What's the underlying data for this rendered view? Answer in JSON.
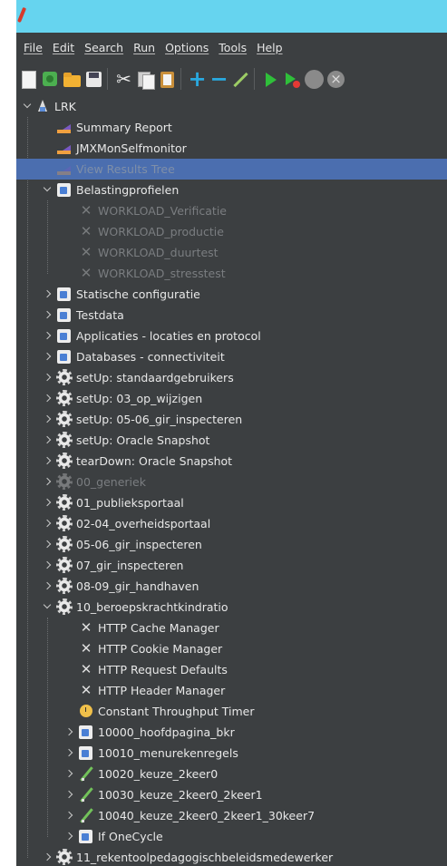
{
  "menu": [
    "File",
    "Edit",
    "Search",
    "Run",
    "Options",
    "Tools",
    "Help"
  ],
  "toolbar": [
    {
      "id": "new",
      "icon": "new-file-icon"
    },
    {
      "id": "templates",
      "icon": "templates-icon"
    },
    {
      "id": "open",
      "icon": "open-folder-icon"
    },
    {
      "id": "save",
      "icon": "save-icon"
    },
    {
      "sep": true
    },
    {
      "id": "cut",
      "icon": "cut-icon",
      "glyph": "✂"
    },
    {
      "id": "copy",
      "icon": "copy-icon"
    },
    {
      "id": "paste",
      "icon": "paste-icon"
    },
    {
      "sep": true
    },
    {
      "id": "expand",
      "icon": "plus-icon",
      "glyph": "+"
    },
    {
      "id": "collapse",
      "icon": "minus-icon",
      "glyph": "−"
    },
    {
      "id": "toggle",
      "icon": "toggle-icon"
    },
    {
      "sep": true
    },
    {
      "id": "start",
      "icon": "start-icon"
    },
    {
      "id": "start-no-pause",
      "icon": "start-no-pauses-icon"
    },
    {
      "id": "stop",
      "icon": "stop-icon"
    },
    {
      "id": "shutdown",
      "icon": "shutdown-icon"
    }
  ],
  "tree": [
    {
      "label": "LRK",
      "icon": "testplan",
      "level": 0,
      "state": "open",
      "enabled": true,
      "selected": false
    },
    {
      "label": "Summary Report",
      "icon": "listener",
      "level": 1,
      "state": "none",
      "enabled": true,
      "selected": false
    },
    {
      "label": "JMXMonSelfmonitor",
      "icon": "listener",
      "level": 1,
      "state": "none",
      "enabled": true,
      "selected": false
    },
    {
      "label": "View Results Tree",
      "icon": "listener",
      "level": 1,
      "state": "none",
      "enabled": false,
      "selected": true
    },
    {
      "label": "Belastingprofielen",
      "icon": "threadgroup",
      "level": 1,
      "state": "open",
      "enabled": true,
      "selected": false
    },
    {
      "label": "WORKLOAD_Verificatie",
      "icon": "config",
      "level": 2,
      "state": "none",
      "enabled": false,
      "selected": false
    },
    {
      "label": "WORKLOAD_productie",
      "icon": "config",
      "level": 2,
      "state": "none",
      "enabled": false,
      "selected": false
    },
    {
      "label": "WORKLOAD_duurtest",
      "icon": "config",
      "level": 2,
      "state": "none",
      "enabled": false,
      "selected": false
    },
    {
      "label": "WORKLOAD_stresstest",
      "icon": "config",
      "level": 2,
      "state": "none",
      "enabled": false,
      "selected": false
    },
    {
      "label": "Statische configuratie",
      "icon": "threadgroup",
      "level": 1,
      "state": "closed",
      "enabled": true,
      "selected": false
    },
    {
      "label": "Testdata",
      "icon": "threadgroup",
      "level": 1,
      "state": "closed",
      "enabled": true,
      "selected": false
    },
    {
      "label": "Applicaties - locaties en protocol",
      "icon": "threadgroup",
      "level": 1,
      "state": "closed",
      "enabled": true,
      "selected": false
    },
    {
      "label": "Databases - connectiviteit",
      "icon": "threadgroup",
      "level": 1,
      "state": "closed",
      "enabled": true,
      "selected": false
    },
    {
      "label": "setUp: standaardgebruikers",
      "icon": "gear",
      "level": 1,
      "state": "closed",
      "enabled": true,
      "selected": false
    },
    {
      "label": "setUp: 03_op_wijzigen",
      "icon": "gear",
      "level": 1,
      "state": "closed",
      "enabled": true,
      "selected": false
    },
    {
      "label": "setUp: 05-06_gir_inspecteren",
      "icon": "gear",
      "level": 1,
      "state": "closed",
      "enabled": true,
      "selected": false
    },
    {
      "label": "setUp: Oracle Snapshot",
      "icon": "gear",
      "level": 1,
      "state": "closed",
      "enabled": true,
      "selected": false
    },
    {
      "label": "tearDown: Oracle Snapshot",
      "icon": "gear",
      "level": 1,
      "state": "closed",
      "enabled": true,
      "selected": false
    },
    {
      "label": "00_generiek",
      "icon": "gear",
      "level": 1,
      "state": "closed",
      "enabled": false,
      "selected": false
    },
    {
      "label": "01_publieksportaal",
      "icon": "gear",
      "level": 1,
      "state": "closed",
      "enabled": true,
      "selected": false
    },
    {
      "label": "02-04_overheidsportaal",
      "icon": "gear",
      "level": 1,
      "state": "closed",
      "enabled": true,
      "selected": false
    },
    {
      "label": "05-06_gir_inspecteren",
      "icon": "gear",
      "level": 1,
      "state": "closed",
      "enabled": true,
      "selected": false
    },
    {
      "label": "07_gir_inspecteren",
      "icon": "gear",
      "level": 1,
      "state": "closed",
      "enabled": true,
      "selected": false
    },
    {
      "label": "08-09_gir_handhaven",
      "icon": "gear",
      "level": 1,
      "state": "closed",
      "enabled": true,
      "selected": false
    },
    {
      "label": "10_beroepskrachtkindratio",
      "icon": "gear",
      "level": 1,
      "state": "open",
      "enabled": true,
      "selected": false
    },
    {
      "label": "HTTP Cache Manager",
      "icon": "config",
      "level": 2,
      "state": "none",
      "enabled": true,
      "selected": false
    },
    {
      "label": "HTTP Cookie Manager",
      "icon": "config",
      "level": 2,
      "state": "none",
      "enabled": true,
      "selected": false
    },
    {
      "label": "HTTP Request Defaults",
      "icon": "config",
      "level": 2,
      "state": "none",
      "enabled": true,
      "selected": false
    },
    {
      "label": "HTTP Header Manager",
      "icon": "config",
      "level": 2,
      "state": "none",
      "enabled": true,
      "selected": false
    },
    {
      "label": "Constant Throughput Timer",
      "icon": "timer",
      "level": 2,
      "state": "none",
      "enabled": true,
      "selected": false
    },
    {
      "label": "10000_hoofdpagina_bkr",
      "icon": "threadgroup",
      "level": 2,
      "state": "closed",
      "enabled": true,
      "selected": false
    },
    {
      "label": "10010_menurekenregels",
      "icon": "threadgroup",
      "level": 2,
      "state": "closed",
      "enabled": true,
      "selected": false
    },
    {
      "label": "10020_keuze_2keer0",
      "icon": "sampler",
      "level": 2,
      "state": "closed",
      "enabled": true,
      "selected": false
    },
    {
      "label": "10030_keuze_2keer0_2keer1",
      "icon": "sampler",
      "level": 2,
      "state": "closed",
      "enabled": true,
      "selected": false
    },
    {
      "label": "10040_keuze_2keer0_2keer1_30keer7",
      "icon": "sampler",
      "level": 2,
      "state": "closed",
      "enabled": true,
      "selected": false
    },
    {
      "label": "If OneCycle",
      "icon": "threadgroup",
      "level": 2,
      "state": "closed",
      "enabled": true,
      "selected": false
    },
    {
      "label": "11_rekentoolpedagogischbeleidsmedewerker",
      "icon": "gear",
      "level": 1,
      "state": "closed",
      "enabled": true,
      "selected": false
    }
  ]
}
